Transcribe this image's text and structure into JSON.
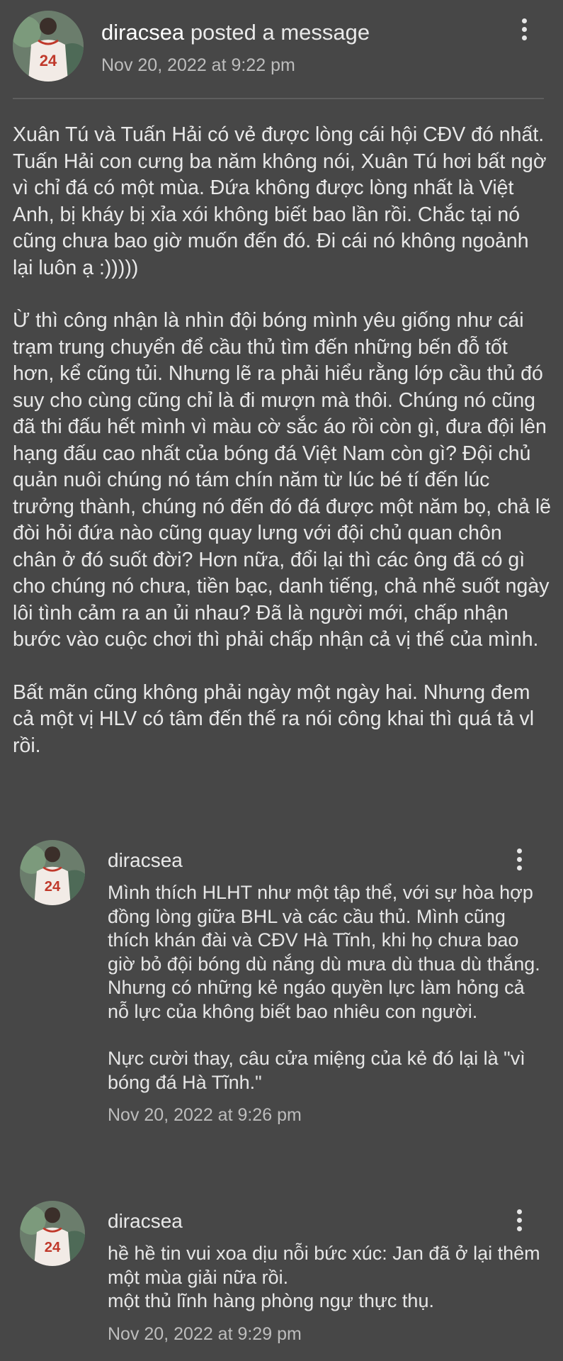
{
  "post": {
    "author": "diracsea",
    "action": "posted a message",
    "timestamp": "Nov 20, 2022 at 9:22 pm",
    "paragraphs": [
      "Xuân Tú và Tuấn Hải có vẻ được lòng cái hội CĐV đó nhất. Tuấn Hải con cưng ba năm không nói, Xuân Tú hơi bất ngờ vì chỉ đá có một mùa. Đứa không được lòng nhất là Việt Anh, bị kháy bị xỉa xói không biết bao lần rồi. Chắc tại nó cũng chưa bao giờ muốn đến đó. Đi cái nó không ngoảnh lại luôn ạ :)))))",
      "Ừ thì công nhận là nhìn đội bóng mình yêu giống như cái trạm trung chuyển để cầu thủ tìm đến những bến đỗ tốt hơn, kể cũng tủi. Nhưng lẽ ra phải hiểu rằng lớp cầu thủ đó suy cho cùng cũng chỉ là đi mượn mà thôi. Chúng nó cũng đã thi đấu hết mình vì màu cờ sắc áo rồi còn gì, đưa đội lên hạng đấu cao nhất của bóng đá Việt Nam còn gì? Đội chủ quản nuôi chúng nó tám chín năm từ lúc bé tí đến lúc trưởng thành, chúng nó đến đó đá được một năm bọ, chả lẽ đòi hỏi đứa nào cũng quay lưng với đội chủ quan chôn chân ở đó suốt đời? Hơn nữa, đổi lại thì các ông đã có gì cho chúng nó chưa, tiền bạc, danh tiếng, chả nhẽ suốt ngày lôi tình cảm ra an ủi nhau? Đã là người mới, chấp nhận bước vào cuộc chơi thì phải chấp nhận cả vị thế của mình.",
      "Bất mãn cũng không phải ngày một ngày hai. Nhưng đem cả một vị HLV có tâm đến thế ra nói công khai thì quá tả vl rồi."
    ]
  },
  "comments": [
    {
      "author": "diracsea",
      "paragraphs": [
        "Mình thích HLHT như một tập thể, với sự hòa hợp đồng lòng giữa BHL và các cầu thủ. Mình cũng thích khán đài và CĐV Hà Tĩnh, khi họ chưa bao giờ bỏ đội bóng dù nắng dù mưa dù thua dù thắng. Nhưng có những kẻ ngáo quyền lực làm hỏng cả nỗ lực của không biết bao nhiêu con người.",
        "Nực cười thay, câu cửa miệng của kẻ đó lại là \"vì bóng đá Hà Tĩnh.\""
      ],
      "timestamp": "Nov 20, 2022 at 9:26 pm"
    },
    {
      "author": "diracsea",
      "paragraphs": [
        "hề hề tin vui xoa dịu nỗi bức xúc: Jan đã ở lại thêm một mùa giải nữa rồi.",
        "một thủ lĩnh hàng phòng ngự thực thụ."
      ],
      "timestamp": "Nov 20, 2022 at 9:29 pm"
    }
  ],
  "icons": {
    "more": "more-vertical-icon",
    "avatar_jersey_number": "24"
  },
  "colors": {
    "background": "#474747",
    "text": "#e8e8e8",
    "muted": "#bdbdbd",
    "jersey": "#f2ebe6",
    "jersey_accent": "#c0392b"
  }
}
